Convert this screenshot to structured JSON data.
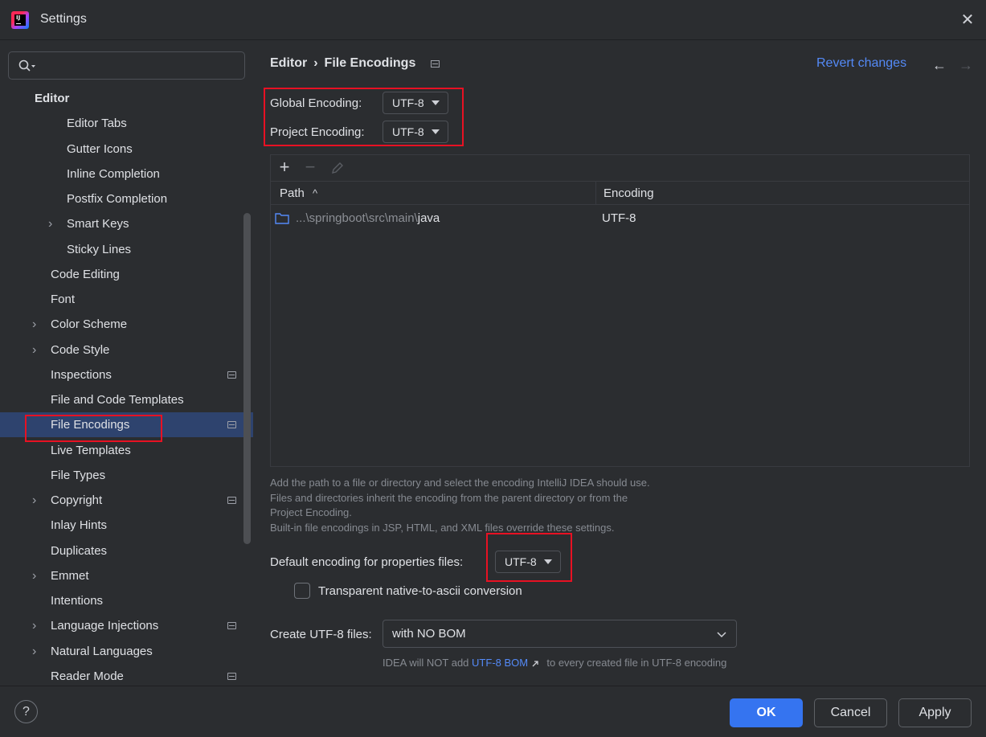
{
  "window": {
    "title": "Settings",
    "close_glyph": "✕"
  },
  "sidebar": {
    "search_placeholder": "",
    "items": [
      {
        "label": "Editor",
        "level": 0,
        "arrow": false,
        "proj": false
      },
      {
        "label": "Editor Tabs",
        "level": 2,
        "arrow": false,
        "proj": false
      },
      {
        "label": "Gutter Icons",
        "level": 2,
        "arrow": false,
        "proj": false
      },
      {
        "label": "Inline Completion",
        "level": 2,
        "arrow": false,
        "proj": false
      },
      {
        "label": "Postfix Completion",
        "level": 2,
        "arrow": false,
        "proj": false
      },
      {
        "label": "Smart Keys",
        "level": 2,
        "arrow": true,
        "proj": false
      },
      {
        "label": "Sticky Lines",
        "level": 2,
        "arrow": false,
        "proj": false
      },
      {
        "label": "Code Editing",
        "level": 1,
        "arrow": false,
        "proj": false
      },
      {
        "label": "Font",
        "level": 1,
        "arrow": false,
        "proj": false
      },
      {
        "label": "Color Scheme",
        "level": 1,
        "arrow": true,
        "proj": false
      },
      {
        "label": "Code Style",
        "level": 1,
        "arrow": true,
        "proj": false
      },
      {
        "label": "Inspections",
        "level": 1,
        "arrow": false,
        "proj": true
      },
      {
        "label": "File and Code Templates",
        "level": 1,
        "arrow": false,
        "proj": false
      },
      {
        "label": "File Encodings",
        "level": 1,
        "arrow": false,
        "proj": true,
        "selected": true
      },
      {
        "label": "Live Templates",
        "level": 1,
        "arrow": false,
        "proj": false
      },
      {
        "label": "File Types",
        "level": 1,
        "arrow": false,
        "proj": false
      },
      {
        "label": "Copyright",
        "level": 1,
        "arrow": true,
        "proj": true
      },
      {
        "label": "Inlay Hints",
        "level": 1,
        "arrow": false,
        "proj": false
      },
      {
        "label": "Duplicates",
        "level": 1,
        "arrow": false,
        "proj": false
      },
      {
        "label": "Emmet",
        "level": 1,
        "arrow": true,
        "proj": false
      },
      {
        "label": "Intentions",
        "level": 1,
        "arrow": false,
        "proj": false
      },
      {
        "label": "Language Injections",
        "level": 1,
        "arrow": true,
        "proj": true
      },
      {
        "label": "Natural Languages",
        "level": 1,
        "arrow": true,
        "proj": false
      },
      {
        "label": "Reader Mode",
        "level": 1,
        "arrow": false,
        "proj": true
      }
    ]
  },
  "main": {
    "breadcrumb": {
      "parent": "Editor",
      "separator": "›",
      "current": "File Encodings"
    },
    "revert_label": "Revert changes",
    "nav_back": "←",
    "nav_forward": "→",
    "global_encoding_label": "Global Encoding:",
    "global_encoding_value": "UTF-8",
    "project_encoding_label": "Project Encoding:",
    "project_encoding_value": "UTF-8",
    "toolbar": {
      "add": "+",
      "remove": "−"
    },
    "table": {
      "columns": [
        "Path",
        "Encoding"
      ],
      "sort_glyph": "^",
      "rows": [
        {
          "path_prefix": "...\\springboot\\src\\main\\",
          "path_name": "java",
          "encoding": "UTF-8"
        }
      ]
    },
    "help_lines": [
      "Add the path to a file or directory and select the encoding IntelliJ IDEA should use.",
      "Files and directories inherit the encoding from the parent directory or from the",
      "Project Encoding.",
      "Built-in file encodings in JSP, HTML, and XML files override these settings."
    ],
    "properties_label": "Default encoding for properties files:",
    "properties_value": "UTF-8",
    "native_ascii_label": "Transparent native-to-ascii conversion",
    "bom_label": "Create UTF-8 files:",
    "bom_value": "with NO BOM",
    "bom_hint_before": "IDEA will NOT add",
    "bom_hint_link": "UTF-8 BOM",
    "bom_hint_after": "to every created file in UTF-8 encoding"
  },
  "footer": {
    "help": "?",
    "ok": "OK",
    "cancel": "Cancel",
    "apply": "Apply"
  },
  "colors": {
    "accent": "#3574f0",
    "link": "#548af7",
    "highlight": "#e81123",
    "selection": "#2e436e"
  }
}
